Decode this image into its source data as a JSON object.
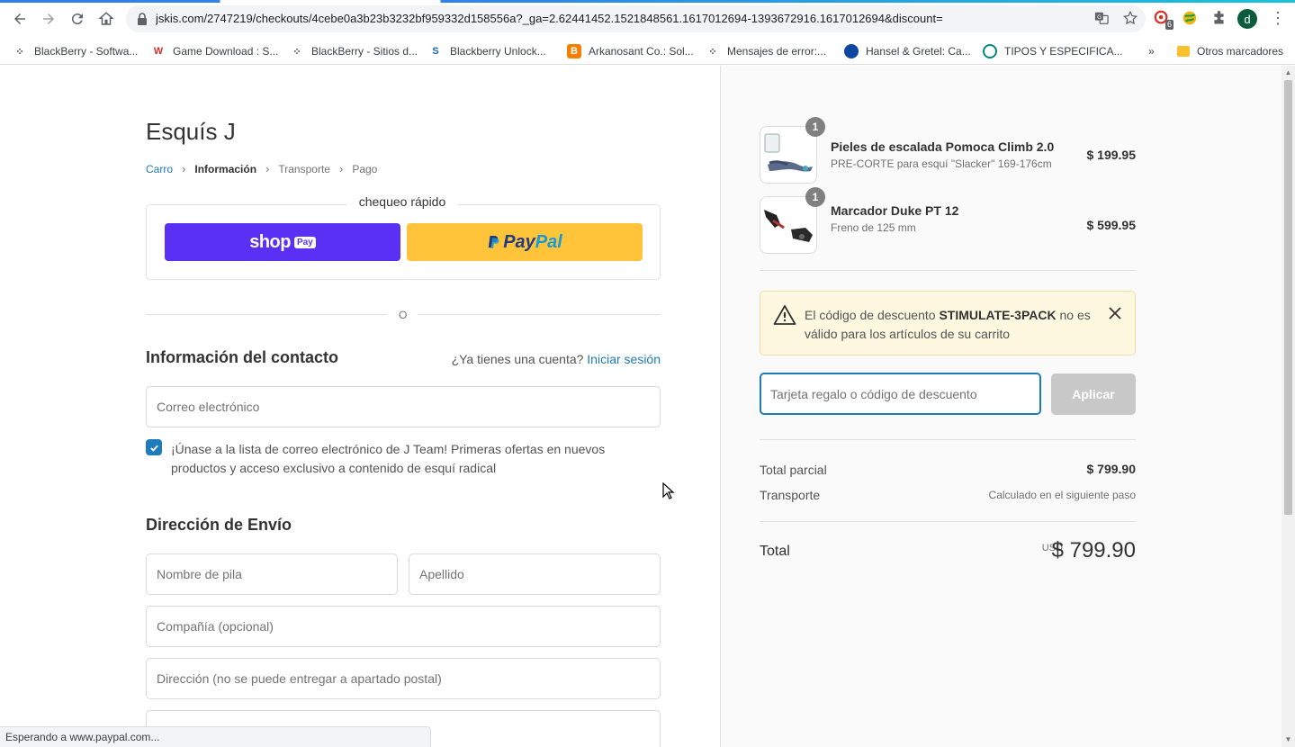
{
  "browser": {
    "url": "jskis.com/2747219/checkouts/4cebe0a3b23b3232bf959332d158556a?_ga=2.62441452.1521848561.1617012694-1393672916.1617012694&discount=",
    "ext_badge": "6",
    "profile_initial": "d",
    "bookmarks": [
      {
        "label": "BlackBerry - Softwa...",
        "icon": "blackberry-icon"
      },
      {
        "label": "Game Download : S...",
        "icon": "w-logo-icon"
      },
      {
        "label": "BlackBerry - Sitios d...",
        "icon": "blackberry-icon"
      },
      {
        "label": "Blackberry Unlock...",
        "icon": "s-logo-icon"
      },
      {
        "label": "Arkanosant Co.: Sol...",
        "icon": "blogger-icon"
      },
      {
        "label": "Mensajes de error:...",
        "icon": "blackberry-icon"
      },
      {
        "label": "Hansel & Gretel: Ca...",
        "icon": "globe-icon"
      },
      {
        "label": "TIPOS Y ESPECIFICA...",
        "icon": "circle-logo-icon"
      }
    ],
    "other_bookmarks": "Otros marcadores",
    "status_text": "Esperando a www.paypal.com..."
  },
  "checkout": {
    "shop_name": "Esquís J",
    "breadcrumb": [
      "Carro",
      "Información",
      "Transporte",
      "Pago"
    ],
    "express_title": "chequeo rápido",
    "shoppay_word": "shop",
    "shoppay_badge": "Pay",
    "paypal_p1": "Pay",
    "paypal_p2": "Pal",
    "divider_text": "O",
    "contact_heading": "Información del contacto",
    "account_question": "¿Ya tienes una cuenta?",
    "login_link": "Iniciar sesión",
    "email_placeholder": "Correo electrónico",
    "newsletter_label": "¡Únase a la lista de correo electrónico de J Team! Primeras ofertas en nuevos productos y acceso exclusivo a contenido de esquí radical",
    "newsletter_checked": true,
    "shipping_heading": "Dirección de Envío",
    "first_name_placeholder": "Nombre de pila",
    "last_name_placeholder": "Apellido",
    "company_placeholder": "Compañía (opcional)",
    "address_placeholder": "Dirección (no se puede entregar a apartado postal)"
  },
  "summary": {
    "items": [
      {
        "qty": "1",
        "name": "Pieles de escalada Pomoca Climb 2.0",
        "variant": "PRE-CORTE para esquí \"Slacker\" 169-176cm",
        "price": "$ 199.95"
      },
      {
        "qty": "1",
        "name": "Marcador Duke PT 12",
        "variant": "Freno de 125 mm",
        "price": "$ 599.95"
      }
    ],
    "alert_pre": "El código de descuento",
    "alert_code": "STIMULATE-3PACK",
    "alert_post": "no es válido para los artículos de su carrito",
    "discount_placeholder": "Tarjeta regalo o código de descuento",
    "apply_label": "Aplicar",
    "subtotal_label": "Total parcial",
    "subtotal_value": "$ 799.90",
    "shipping_label": "Transporte",
    "shipping_value": "Calculado en el siguiente paso",
    "total_label": "Total",
    "total_currency": "USD",
    "total_value": "$ 799.90"
  },
  "colors": {
    "accent": "#1e7ab8",
    "shoppay": "#5a31f4",
    "paypal": "#ffc439",
    "alert_bg": "#fff8e1"
  }
}
